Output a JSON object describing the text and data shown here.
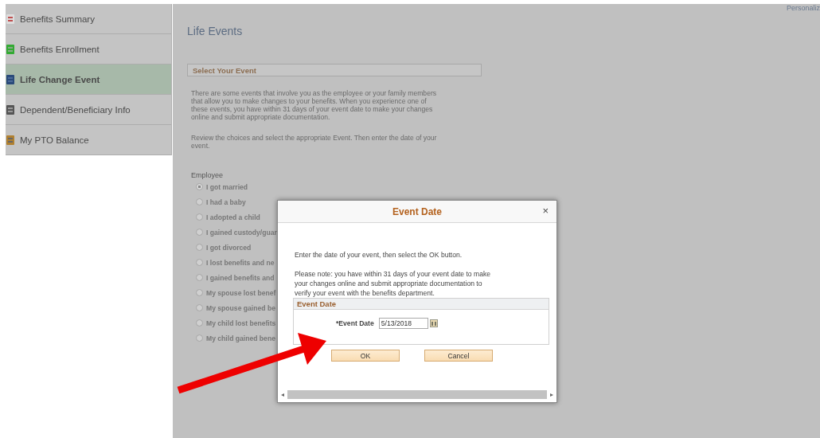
{
  "top_link": "Personaliz",
  "sidebar": {
    "items": [
      {
        "label": "Benefits Summary",
        "selected": false
      },
      {
        "label": "Benefits Enrollment",
        "selected": false
      },
      {
        "label": "Life Change Event",
        "selected": true
      },
      {
        "label": "Dependent/Beneficiary Info",
        "selected": false
      },
      {
        "label": "My PTO Balance",
        "selected": false
      }
    ]
  },
  "page": {
    "title": "Life Events",
    "section_title": "Select Your Event",
    "paragraphs": [
      "There are some events that involve you as the employee or your family members that allow you to make changes to your benefits. When you experience one of these events, you have within 31 days of your event date to make your changes online and submit appropriate documentation.",
      "Review the choices and select the appropriate Event. Then enter the date of your event."
    ],
    "group_label": "Employee",
    "events": [
      {
        "label": "I got married",
        "selected": true
      },
      {
        "label": "I had a baby",
        "selected": false
      },
      {
        "label": "I adopted a child",
        "selected": false
      },
      {
        "label": "I gained custody/guar",
        "selected": false
      },
      {
        "label": "I got divorced",
        "selected": false
      },
      {
        "label": "I lost benefits and ne",
        "selected": false
      },
      {
        "label": "I gained benefits and",
        "selected": false
      },
      {
        "label": "My spouse lost benef",
        "selected": false
      },
      {
        "label": "My spouse gained be",
        "selected": false
      },
      {
        "label": "My child lost benefits",
        "selected": false
      },
      {
        "label": "My child gained bene",
        "selected": false
      }
    ]
  },
  "dialog": {
    "title": "Event Date",
    "close": "×",
    "instruction": "Enter the date of your event, then select the OK button.",
    "note": "Please note: you have within 31 days of your event date to make your changes online and submit appropriate documentation to verify your event with the benefits department.",
    "group_title": "Event Date",
    "field_label": "*Event Date",
    "field_value": "5/13/2018",
    "buttons": [
      "OK",
      "Cancel"
    ],
    "scroll_left": "◂",
    "scroll_right": "▸"
  }
}
